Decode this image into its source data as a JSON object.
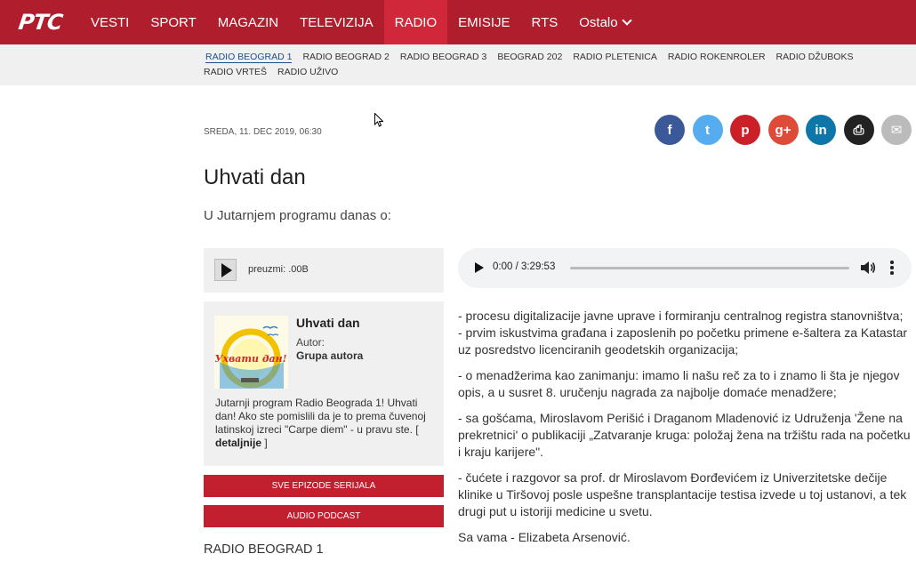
{
  "nav": {
    "logo": "РТС",
    "items": [
      "VESTI",
      "SPORT",
      "MAGAZIN",
      "TELEVIZIJA",
      "RADIO",
      "EMISIJE",
      "RTS"
    ],
    "active": "RADIO",
    "more_label": "Ostalo"
  },
  "subnav": {
    "items": [
      "RADIO BEOGRAD 1",
      "RADIO BEOGRAD 2",
      "RADIO BEOGRAD 3",
      "BEOGRAD 202",
      "RADIO PLETENICA",
      "RADIO ROKENROLER",
      "RADIO DŽUBOKS",
      "RADIO VRTEŠ",
      "RADIO UŽIVO"
    ],
    "active": "RADIO BEOGRAD 1"
  },
  "article": {
    "date": "SREDA, 11. DEC 2019, 06:30",
    "title": "Uhvati dan",
    "lead": "U Jutarnjem programu danas o:",
    "paragraphs": [
      "- procesu digitalizacije javne uprave i formiranju centralnog registra stanovništva;",
      "- prvim iskustvima građana i zaposlenih po početku primene e-šaltera za Katastar uz posredstvo licenciranih geodetskih organizacija;",
      "- o menadžerima kao zanimanju: imamo li našu reč za to i znamo li šta je njegov opis, a u susret 8. uručenju nagrada za najbolje domaće menadžere;",
      "- sa gošćama, Miroslavom Perišić i Draganom Mladenović iz Udruženja 'Žene na prekretnici' o publikaciji „Zatvaranje kruga: položaj žena na tržištu rada na početku i kraju karijere\".",
      "- čućete i razgovor sa prof. dr Miroslavom Đorđevićem iz Univerzitetske dečije klinike u Tiršovoj posle uspešne transplantacije testisa izvede u toj ustanovi, a tek drugi put u istoriji medicine u svetu.",
      "Sa vama - Elizabeta Arsenović."
    ]
  },
  "share": [
    {
      "name": "facebook",
      "glyph": "f",
      "color": "#3b5998"
    },
    {
      "name": "twitter",
      "glyph": "t",
      "color": "#55acee"
    },
    {
      "name": "pinterest",
      "glyph": "p",
      "color": "#cb2027"
    },
    {
      "name": "google-plus",
      "glyph": "g+",
      "color": "#dd4b39"
    },
    {
      "name": "linkedin",
      "glyph": "in",
      "color": "#0e76a8"
    },
    {
      "name": "print",
      "glyph": "⎙",
      "color": "#222222"
    },
    {
      "name": "email",
      "glyph": "✉",
      "color": "#bbbbbb"
    }
  ],
  "player": {
    "download_label": "preuzmi: .00B",
    "time": "0:00 / 3:29:53"
  },
  "show": {
    "title": "Uhvati dan",
    "author_label": "Autor:",
    "author": "Grupa autora",
    "description": "Jutarnji program Radio Beograda 1! Uhvati dan! Ako ste pomislili da je to prema čuvenoj latinskoj izreci \"Carpe diem\" - u pravu ste. [",
    "more_label": "detaljnije",
    "description_end": " ]",
    "thumb_text": "Ухвати дан!"
  },
  "buttons": {
    "all_episodes": "SVE EPIZODE SERIJALA",
    "podcast": "AUDIO PODCAST"
  },
  "section_label": "RADIO BEOGRAD 1",
  "colors": {
    "brand_red": "#b01e2e",
    "active_red": "#d0283a",
    "button_red": "#c21f2f",
    "link_blue": "#1a4f8a"
  }
}
